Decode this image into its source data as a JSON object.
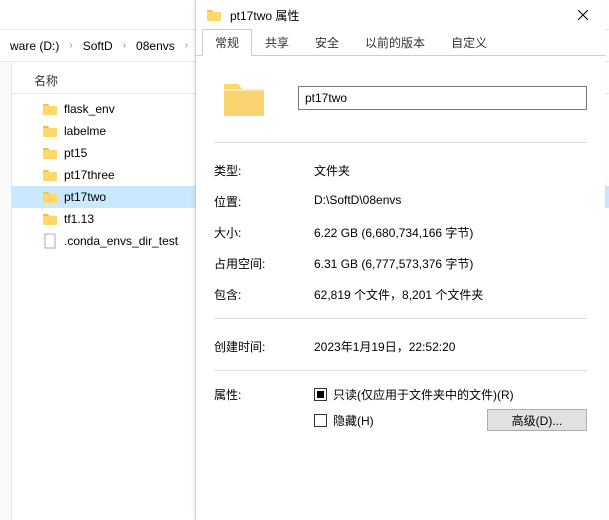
{
  "explorer": {
    "breadcrumb": [
      "ware (D:)",
      "SoftD",
      "08envs"
    ],
    "column_header": "名称",
    "items": [
      {
        "name": "flask_env",
        "type": "folder",
        "selected": false
      },
      {
        "name": "labelme",
        "type": "folder",
        "selected": false
      },
      {
        "name": "pt15",
        "type": "folder",
        "selected": false
      },
      {
        "name": "pt17three",
        "type": "folder",
        "selected": false
      },
      {
        "name": "pt17two",
        "type": "folder",
        "selected": true
      },
      {
        "name": "tf1.13",
        "type": "folder",
        "selected": false
      },
      {
        "name": ".conda_envs_dir_test",
        "type": "file",
        "selected": false
      }
    ]
  },
  "props": {
    "title": "pt17two 属性",
    "tabs": [
      "常规",
      "共享",
      "安全",
      "以前的版本",
      "自定义"
    ],
    "active_tab": 0,
    "name_value": "pt17two",
    "rows": {
      "type_label": "类型:",
      "type_value": "文件夹",
      "location_label": "位置:",
      "location_value": "D:\\SoftD\\08envs",
      "size_label": "大小:",
      "size_value": "6.22 GB (6,680,734,166 字节)",
      "ondisk_label": "占用空间:",
      "ondisk_value": "6.31 GB (6,777,573,376 字节)",
      "contains_label": "包含:",
      "contains_value": "62,819 个文件，8,201 个文件夹",
      "created_label": "创建时间:",
      "created_value": "2023年1月19日，22:52:20",
      "attr_label": "属性:",
      "readonly_text": "只读(仅应用于文件夹中的文件)(R)",
      "hidden_text": "隐藏(H)",
      "advanced_btn": "高级(D)..."
    }
  }
}
